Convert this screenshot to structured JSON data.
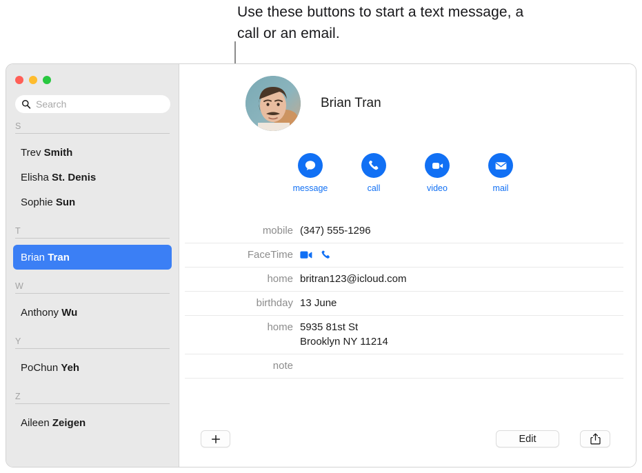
{
  "annotation": {
    "text": "Use these buttons to start a text message, a call or an email.",
    "line_color": "#8b8b8b"
  },
  "window": {
    "traffic_lights": [
      {
        "name": "close",
        "color": "#ff5f57"
      },
      {
        "name": "minimize",
        "color": "#febc2e"
      },
      {
        "name": "zoom",
        "color": "#28c840"
      }
    ]
  },
  "sidebar": {
    "search": {
      "placeholder": "Search",
      "value": "",
      "icon": "search-icon"
    },
    "sections": [
      {
        "letter": "S",
        "contacts": [
          {
            "first": "Trev",
            "last": "Smith",
            "selected": false
          },
          {
            "first": "Elisha",
            "last": "St. Denis",
            "selected": false
          },
          {
            "first": "Sophie",
            "last": "Sun",
            "selected": false
          }
        ]
      },
      {
        "letter": "T",
        "contacts": [
          {
            "first": "Brian",
            "last": "Tran",
            "selected": true
          }
        ]
      },
      {
        "letter": "W",
        "contacts": [
          {
            "first": "Anthony",
            "last": "Wu",
            "selected": false
          }
        ]
      },
      {
        "letter": "Y",
        "contacts": [
          {
            "first": "PoChun",
            "last": "Yeh",
            "selected": false
          }
        ]
      },
      {
        "letter": "Z",
        "contacts": [
          {
            "first": "Aileen",
            "last": "Zeigen",
            "selected": false
          }
        ]
      }
    ],
    "selection_color": "#3b7ff5"
  },
  "detail": {
    "name": "Brian Tran",
    "avatar": "contact-photo",
    "accent_color": "#1170f4",
    "actions": [
      {
        "label": "message",
        "icon": "message-bubble-icon"
      },
      {
        "label": "call",
        "icon": "phone-icon"
      },
      {
        "label": "video",
        "icon": "video-camera-icon"
      },
      {
        "label": "mail",
        "icon": "envelope-icon"
      }
    ],
    "fields": [
      {
        "label": "mobile",
        "value": "(347) 555-1296",
        "type": "text"
      },
      {
        "label": "FaceTime",
        "value": "",
        "type": "icons",
        "icons": [
          "video-camera-icon",
          "phone-icon"
        ]
      },
      {
        "label": "home",
        "value": "britran123@icloud.com",
        "type": "text"
      },
      {
        "label": "birthday",
        "value": "13 June",
        "type": "text"
      },
      {
        "label": "home",
        "value": "5935 81st St\nBrooklyn NY 11214",
        "type": "text"
      },
      {
        "label": "note",
        "value": "",
        "type": "text"
      }
    ]
  },
  "toolbar": {
    "add_label": "+",
    "edit_label": "Edit",
    "share_icon": "share-icon"
  }
}
